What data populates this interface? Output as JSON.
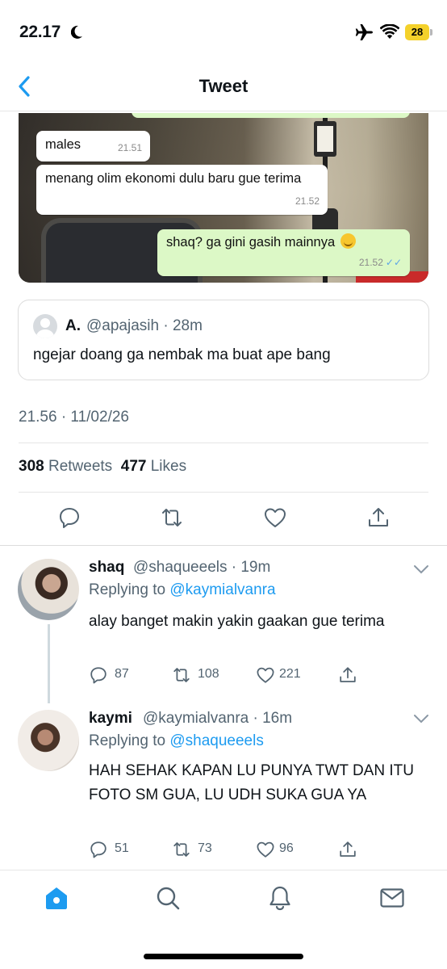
{
  "status_bar": {
    "time": "22.17",
    "battery": "28"
  },
  "header": {
    "title": "Tweet"
  },
  "chat_image": {
    "messages": [
      {
        "text": "males",
        "time": "21.51",
        "direction": "in"
      },
      {
        "text": "menang olim ekonomi dulu baru gue terima",
        "time": "21.52",
        "direction": "in"
      },
      {
        "text": "shaq? ga gini gasih mainnya",
        "time": "21.52",
        "direction": "out"
      }
    ]
  },
  "quote": {
    "name": "A.",
    "handle": "@apajasih · 28m",
    "text": "ngejar doang ga nembak ma buat ape bang"
  },
  "tweet": {
    "timestamp": "21.56 · 11/02/26",
    "retweets_count": "308",
    "retweets_label": "Retweets",
    "likes_count": "477",
    "likes_label": "Likes"
  },
  "replies": [
    {
      "name": "shaq",
      "handle": "@shaqueeels · 19m",
      "replying_prefix": "Replying to",
      "replying_to": "@kaymialvanra",
      "text": "alay banget makin yakin gaakan gue terima",
      "replies": "87",
      "retweets": "108",
      "likes": "221"
    },
    {
      "name": "kaymi",
      "handle": "@kaymialvanra · 16m",
      "replying_prefix": "Replying to",
      "replying_to": "@shaqueeels",
      "text": "HAH SEHAK KAPAN LU PUNYA TWT DAN ITU FOTO SM GUA, LU UDH SUKA GUA YA",
      "replies": "51",
      "retweets": "73",
      "likes": "96"
    }
  ],
  "tab_bar": {
    "items": [
      "home-icon",
      "search-icon",
      "notifications-icon",
      "messages-icon"
    ],
    "active": "home-icon"
  },
  "colors": {
    "accent": "#1d9bf0",
    "secondary_text": "#536471",
    "chat_out": "#dcf8c6"
  }
}
